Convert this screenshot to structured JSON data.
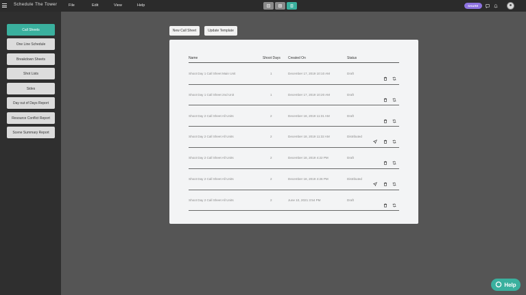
{
  "app": {
    "title": "Schedule The Tower"
  },
  "menu": [
    "File",
    "Edit",
    "View",
    "Help"
  ],
  "view_toggles": [
    {
      "icon": "list-view-icon",
      "active": false
    },
    {
      "icon": "grid-view-icon",
      "active": false
    },
    {
      "icon": "document-view-icon",
      "active": true
    }
  ],
  "share": {
    "label": "SHARE"
  },
  "top_icons": [
    "comment-icon",
    "notification-icon"
  ],
  "sidebar": {
    "items": [
      {
        "label": "Call Sheets",
        "active": true
      },
      {
        "label": "One Line Schedule",
        "active": false
      },
      {
        "label": "Breakdown Sheets",
        "active": false
      },
      {
        "label": "Shot Lists",
        "active": false
      },
      {
        "label": "Sides",
        "active": false
      },
      {
        "label": "Day out of Days Report",
        "active": false
      },
      {
        "label": "Resource Conflict Report",
        "active": false
      },
      {
        "label": "Scene Summary Report",
        "active": false
      }
    ]
  },
  "actions": {
    "new_label": "New Call Sheet",
    "update_label": "Update Template"
  },
  "table": {
    "headers": {
      "name": "Name",
      "shoot_days": "Shoot Days",
      "created_on": "Created On",
      "status": "Status"
    },
    "rows": [
      {
        "name": "Shoot Day 1 Call Sheet Main Unit",
        "shoot_days": "1",
        "created_on": "December 17, 2019 10:10 AM",
        "status": "Draft",
        "sendable": false
      },
      {
        "name": "Shoot Day 1 Call Sheet 2nd Unit",
        "shoot_days": "1",
        "created_on": "December 17, 2019 10:20 AM",
        "status": "Draft",
        "sendable": false
      },
      {
        "name": "Shoot Day 2 Call Sheet All Units",
        "shoot_days": "2",
        "created_on": "December 18, 2019 11:31 AM",
        "status": "Draft",
        "sendable": false
      },
      {
        "name": "Shoot Day 2 Call Sheet All Units",
        "shoot_days": "2",
        "created_on": "December 18, 2019 11:32 AM",
        "status": "Distributed",
        "sendable": true
      },
      {
        "name": "Shoot Day 2 Call Sheet All Units",
        "shoot_days": "2",
        "created_on": "December 18, 2019 4:22 PM",
        "status": "Draft",
        "sendable": false
      },
      {
        "name": "Shoot Day 2 Call Sheet All Units",
        "shoot_days": "2",
        "created_on": "December 18, 2019 4:26 PM",
        "status": "Distributed",
        "sendable": true
      },
      {
        "name": "Shoot Day 2 Call Sheet All Units",
        "shoot_days": "2",
        "created_on": "June 10, 2021 3:54 PM",
        "status": "Draft",
        "sendable": false
      }
    ]
  },
  "help": {
    "label": "Help"
  },
  "colors": {
    "accent": "#3ab09e",
    "share": "#8d73e0",
    "topbar": "#2b2b2b",
    "sidebar": "#2f2f2f",
    "content_bg": "#555555"
  }
}
